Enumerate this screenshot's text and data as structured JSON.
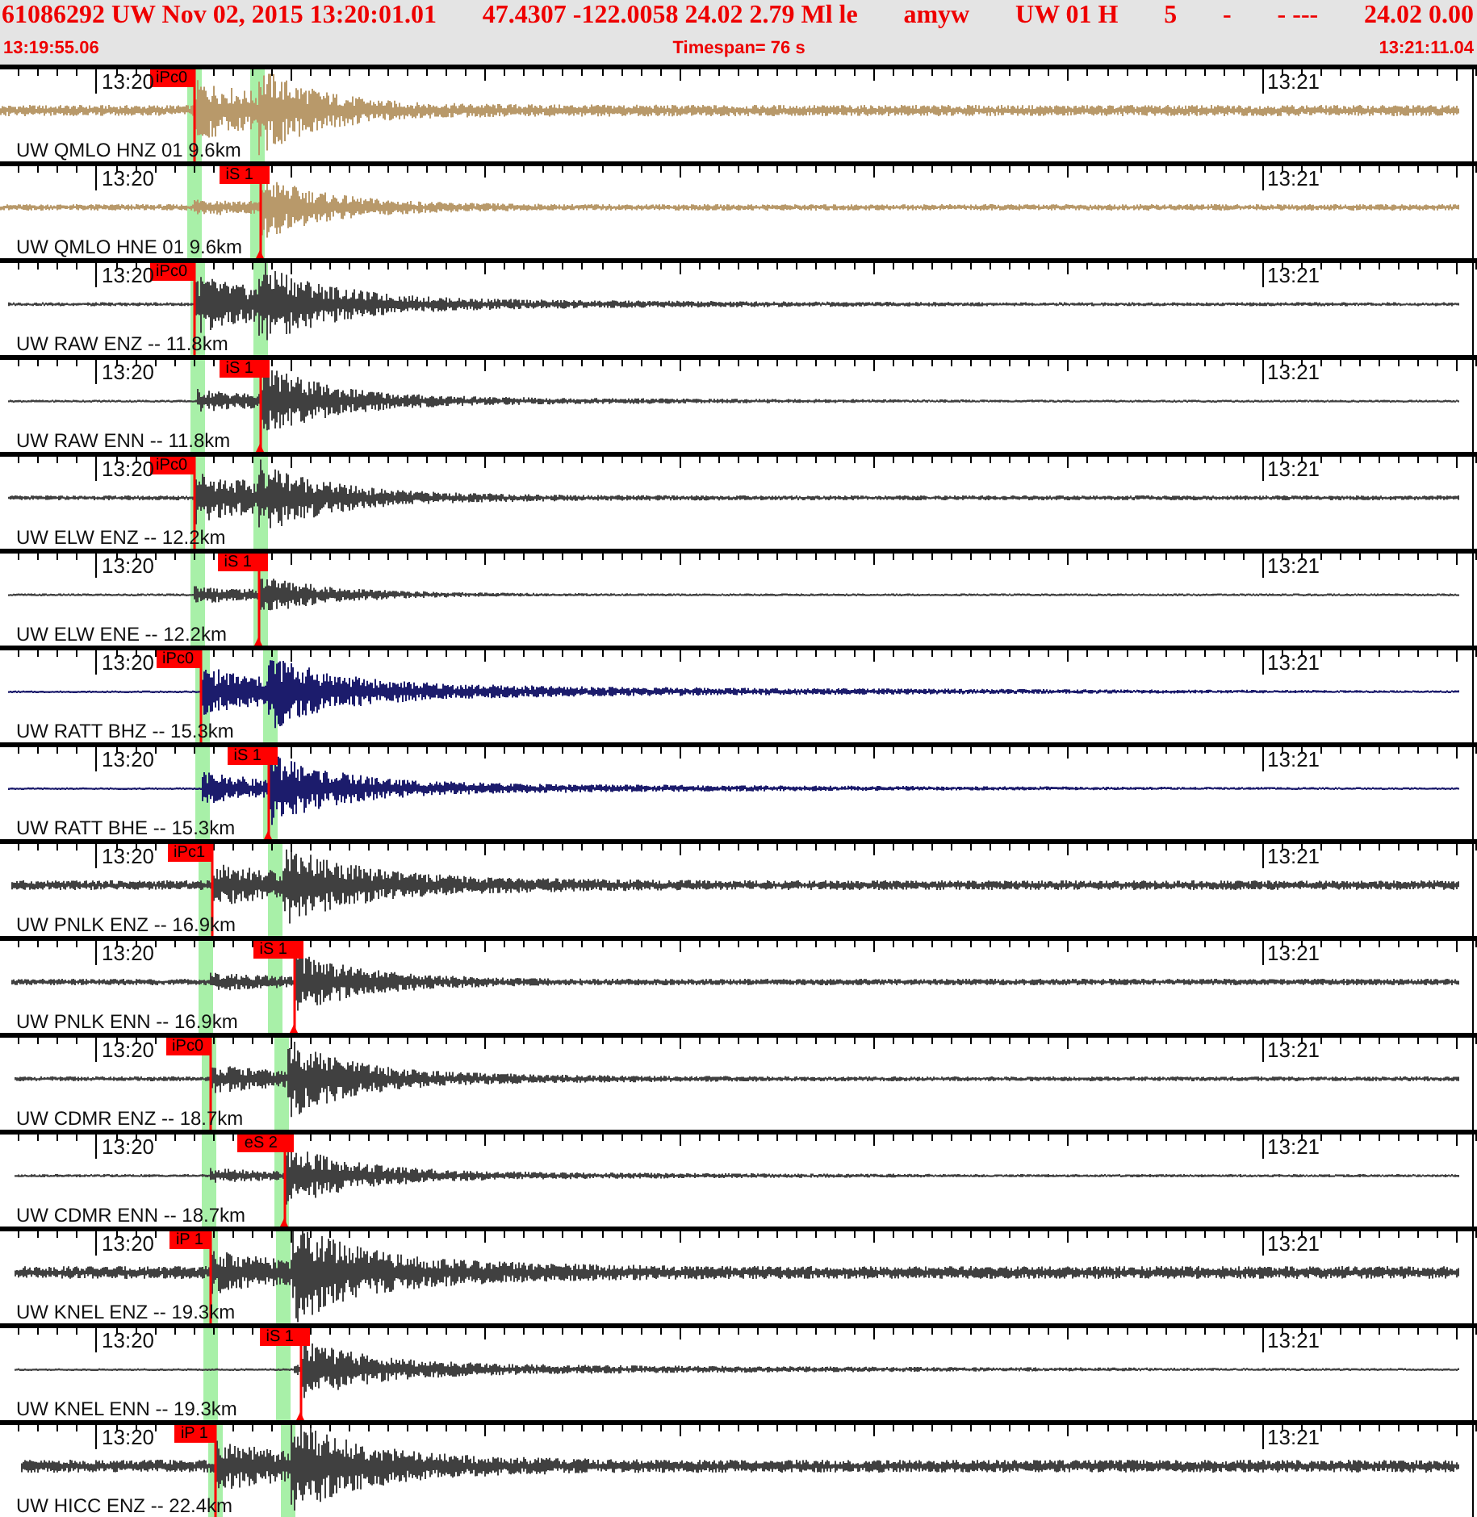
{
  "header": {
    "event": [
      "61086292 UW Nov 02, 2015 13:20:01.01",
      "47.4307 -122.0058 24.02 2.79 Ml le",
      "amyw",
      "UW 01 H",
      "5",
      "-",
      "- ---",
      "24.02 0.00"
    ],
    "start_time": "13:19:55.06",
    "timespan": "Timespan=  76 s",
    "end_time": "13:21:11.04"
  },
  "panels": [
    {
      "channel": "UW QMLO HNZ 01 9.6km",
      "minute_1": "13:20",
      "minute_2": "13:21",
      "color": "#b8996a",
      "pick": {
        "kind": "p",
        "label": "iPc0"
      }
    },
    {
      "channel": "UW QMLO HNE 01 9.6km",
      "minute_1": "13:20",
      "minute_2": "13:21",
      "color": "#b8996a",
      "pick": {
        "kind": "s",
        "label": "iS 1"
      }
    },
    {
      "channel": "UW RAW ENZ -- 11.8km",
      "minute_1": "13:20",
      "minute_2": "13:21",
      "color": "#404040",
      "pick": {
        "kind": "p",
        "label": "iPc0"
      }
    },
    {
      "channel": "UW RAW ENN -- 11.8km",
      "minute_1": "13:20",
      "minute_2": "13:21",
      "color": "#404040",
      "pick": {
        "kind": "s",
        "label": "iS 1"
      }
    },
    {
      "channel": "UW ELW ENZ -- 12.2km",
      "minute_1": "13:20",
      "minute_2": "13:21",
      "color": "#404040",
      "pick": {
        "kind": "p",
        "label": "iPc0"
      }
    },
    {
      "channel": "UW ELW ENE -- 12.2km",
      "minute_1": "13:20",
      "minute_2": "13:21",
      "color": "#404040",
      "pick": {
        "kind": "s",
        "label": "iS 1"
      }
    },
    {
      "channel": "UW RATT BHZ -- 15.3km",
      "minute_1": "13:20",
      "minute_2": "13:21",
      "color": "#1c1c6c",
      "pick": {
        "kind": "p",
        "label": "iPc0"
      }
    },
    {
      "channel": "UW RATT BHE -- 15.3km",
      "minute_1": "13:20",
      "minute_2": "13:21",
      "color": "#1c1c6c",
      "pick": {
        "kind": "s",
        "label": "iS 1"
      }
    },
    {
      "channel": "UW PNLK ENZ -- 16.9km",
      "minute_1": "13:20",
      "minute_2": "13:21",
      "color": "#404040",
      "pick": {
        "kind": "p",
        "label": "iPc1"
      }
    },
    {
      "channel": "UW PNLK ENN -- 16.9km",
      "minute_1": "13:20",
      "minute_2": "13:21",
      "color": "#404040",
      "pick": {
        "kind": "s",
        "label": "iS 1"
      }
    },
    {
      "channel": "UW CDMR ENZ -- 18.7km",
      "minute_1": "13:20",
      "minute_2": "13:21",
      "color": "#404040",
      "pick": {
        "kind": "p",
        "label": "iPc0"
      }
    },
    {
      "channel": "UW CDMR ENN -- 18.7km",
      "minute_1": "13:20",
      "minute_2": "13:21",
      "color": "#404040",
      "pick": {
        "kind": "s",
        "label": "eS 2"
      }
    },
    {
      "channel": "UW KNEL ENZ -- 19.3km",
      "minute_1": "13:20",
      "minute_2": "13:21",
      "color": "#404040",
      "pick": {
        "kind": "p",
        "label": "iP 1"
      }
    },
    {
      "channel": "UW KNEL ENN -- 19.3km",
      "minute_1": "13:20",
      "minute_2": "13:21",
      "color": "#404040",
      "pick": {
        "kind": "s",
        "label": "iS 1"
      }
    },
    {
      "channel": "UW HICC ENZ -- 22.4km",
      "minute_1": "13:20",
      "minute_2": "13:21",
      "color": "#404040",
      "pick": {
        "kind": "p",
        "label": "iP 1"
      }
    }
  ]
}
